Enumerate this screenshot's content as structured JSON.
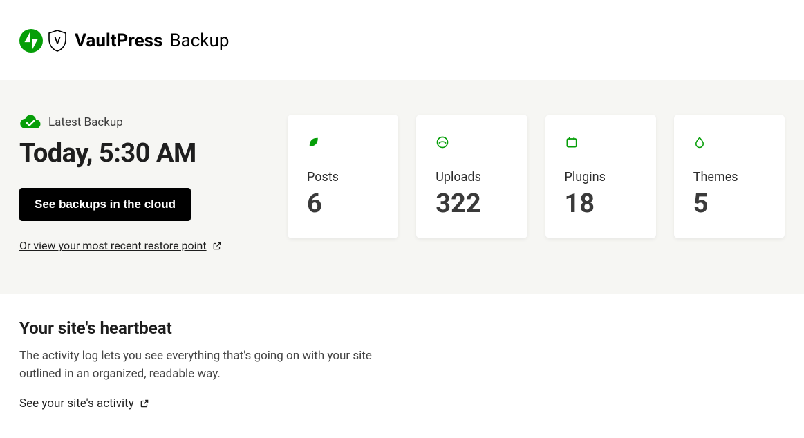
{
  "header": {
    "brand_bold": "VaultPress",
    "brand_light": "Backup"
  },
  "latest": {
    "label": "Latest Backup",
    "time": "Today, 5:30 AM",
    "button": "See backups in the cloud",
    "restore_link": "Or view your most recent restore point"
  },
  "stats": {
    "posts": {
      "label": "Posts",
      "value": "6"
    },
    "uploads": {
      "label": "Uploads",
      "value": "322"
    },
    "plugins": {
      "label": "Plugins",
      "value": "18"
    },
    "themes": {
      "label": "Themes",
      "value": "5"
    }
  },
  "heartbeat": {
    "title": "Your site's heartbeat",
    "desc": "The activity log lets you see everything that's going on with your site outlined in an organized, readable way.",
    "link": "See your site's activity"
  },
  "colors": {
    "accent": "#069e08"
  }
}
